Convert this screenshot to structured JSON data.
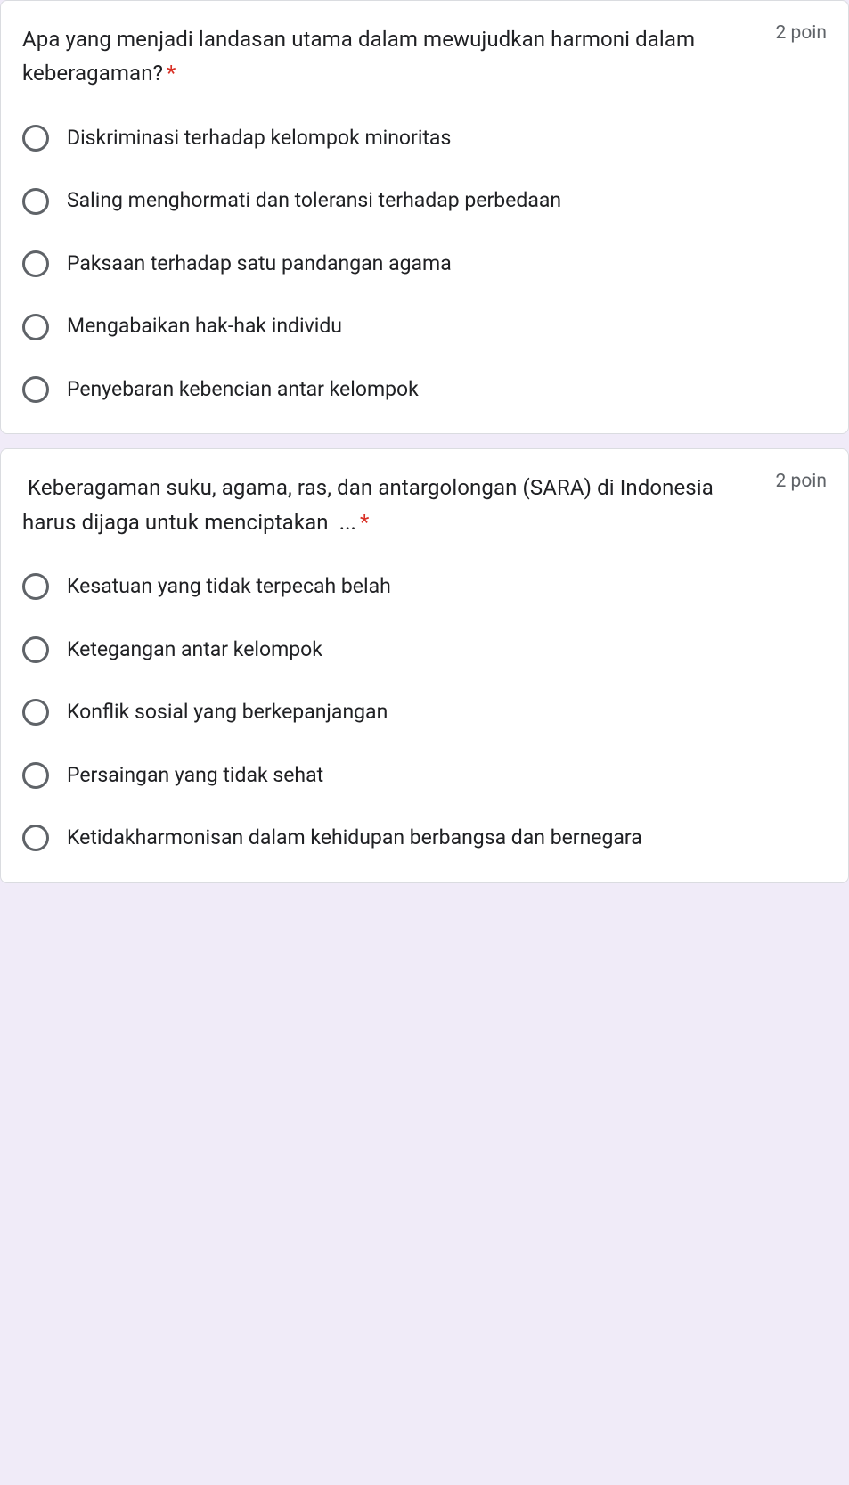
{
  "questions": [
    {
      "text": "Apa yang menjadi landasan utama dalam mewujudkan harmoni dalam keberagaman?",
      "required": "*",
      "points": "2 poin",
      "options": [
        "Diskriminasi terhadap kelompok minoritas",
        "Saling menghormati dan toleransi terhadap perbedaan",
        "Paksaan terhadap satu pandangan agama",
        "Mengabaikan hak-hak individu",
        "Penyebaran kebencian antar kelompok"
      ]
    },
    {
      "text": " Keberagaman suku, agama, ras, dan antargolongan (SARA) di Indonesia harus dijaga untuk menciptakan  ...",
      "required": "*",
      "points": "2 poin",
      "options": [
        "Kesatuan yang tidak terpecah belah",
        "Ketegangan antar kelompok",
        "Konflik sosial yang berkepanjangan",
        "Persaingan yang tidak sehat",
        "Ketidakharmonisan dalam kehidupan berbangsa dan bernegara"
      ]
    }
  ]
}
